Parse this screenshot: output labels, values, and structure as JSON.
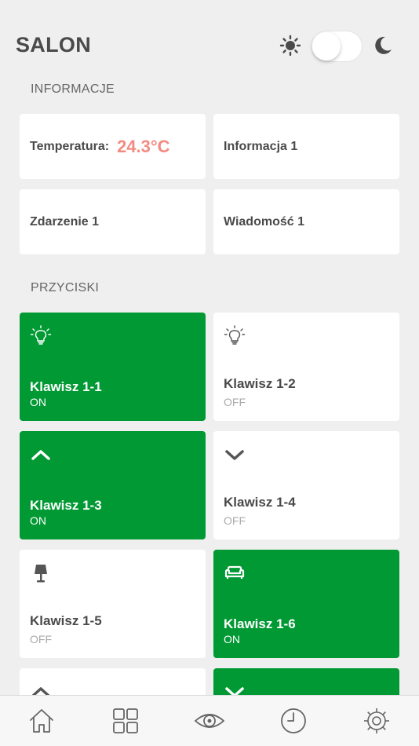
{
  "header": {
    "title": "SALON",
    "sun_icon": "sun-icon",
    "moon_icon": "moon-icon",
    "dark_mode_toggle": false
  },
  "sections": {
    "info_title": "INFORMACJE",
    "buttons_title": "PRZYCISKI"
  },
  "info_cards": [
    {
      "label": "Temperatura:",
      "value": "24.3°C"
    },
    {
      "label": "Informacja 1"
    },
    {
      "label": "Zdarzenie 1"
    },
    {
      "label": "Wiadomość 1"
    }
  ],
  "buttons": [
    {
      "name": "Klawisz 1-1",
      "state": "ON",
      "icon": "lightbulb-icon"
    },
    {
      "name": "Klawisz 1-2",
      "state": "OFF",
      "icon": "lightbulb-icon"
    },
    {
      "name": "Klawisz 1-3",
      "state": "ON",
      "icon": "chevron-up-icon"
    },
    {
      "name": "Klawisz 1-4",
      "state": "OFF",
      "icon": "chevron-down-icon"
    },
    {
      "name": "Klawisz 1-5",
      "state": "OFF",
      "icon": "lamp-icon"
    },
    {
      "name": "Klawisz 1-6",
      "state": "ON",
      "icon": "sofa-icon"
    },
    {
      "icon": "chevron-up-icon",
      "state": "OFF"
    },
    {
      "icon": "chevron-down-icon",
      "state": "ON"
    }
  ],
  "tabbar": {
    "items": [
      "home-icon",
      "grid-icon",
      "eye-icon",
      "clock-icon",
      "settings-gear-icon"
    ]
  },
  "colors": {
    "on": "#009933",
    "off": "#ffffff",
    "background": "#efefef",
    "temperature": "#f28b82"
  }
}
